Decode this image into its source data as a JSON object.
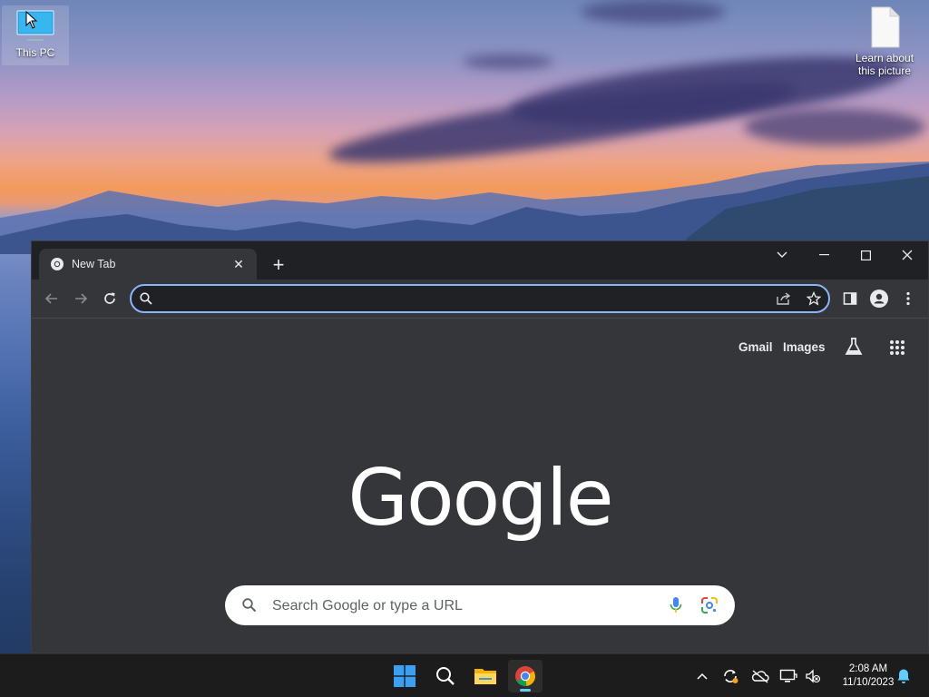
{
  "desktop": {
    "icons": [
      {
        "label": "This PC"
      },
      {
        "label": "Learn about this picture"
      }
    ]
  },
  "browser": {
    "tab": {
      "title": "New Tab"
    },
    "omnibox": {
      "value": ""
    },
    "content": {
      "links": {
        "gmail": "Gmail",
        "images": "Images"
      },
      "logo": "Google",
      "search_placeholder": "Search Google or type a URL"
    }
  },
  "taskbar": {
    "icons": [
      "windows-start",
      "search",
      "file-explorer",
      "chrome"
    ],
    "clock": {
      "time": "2:08 AM",
      "date": "11/10/2023"
    }
  },
  "colors": {
    "accent": "#8ab4f8",
    "browser_bg": "#35363a",
    "taskbar_bg": "#1c1c1c",
    "indicator": "#60cdff"
  }
}
